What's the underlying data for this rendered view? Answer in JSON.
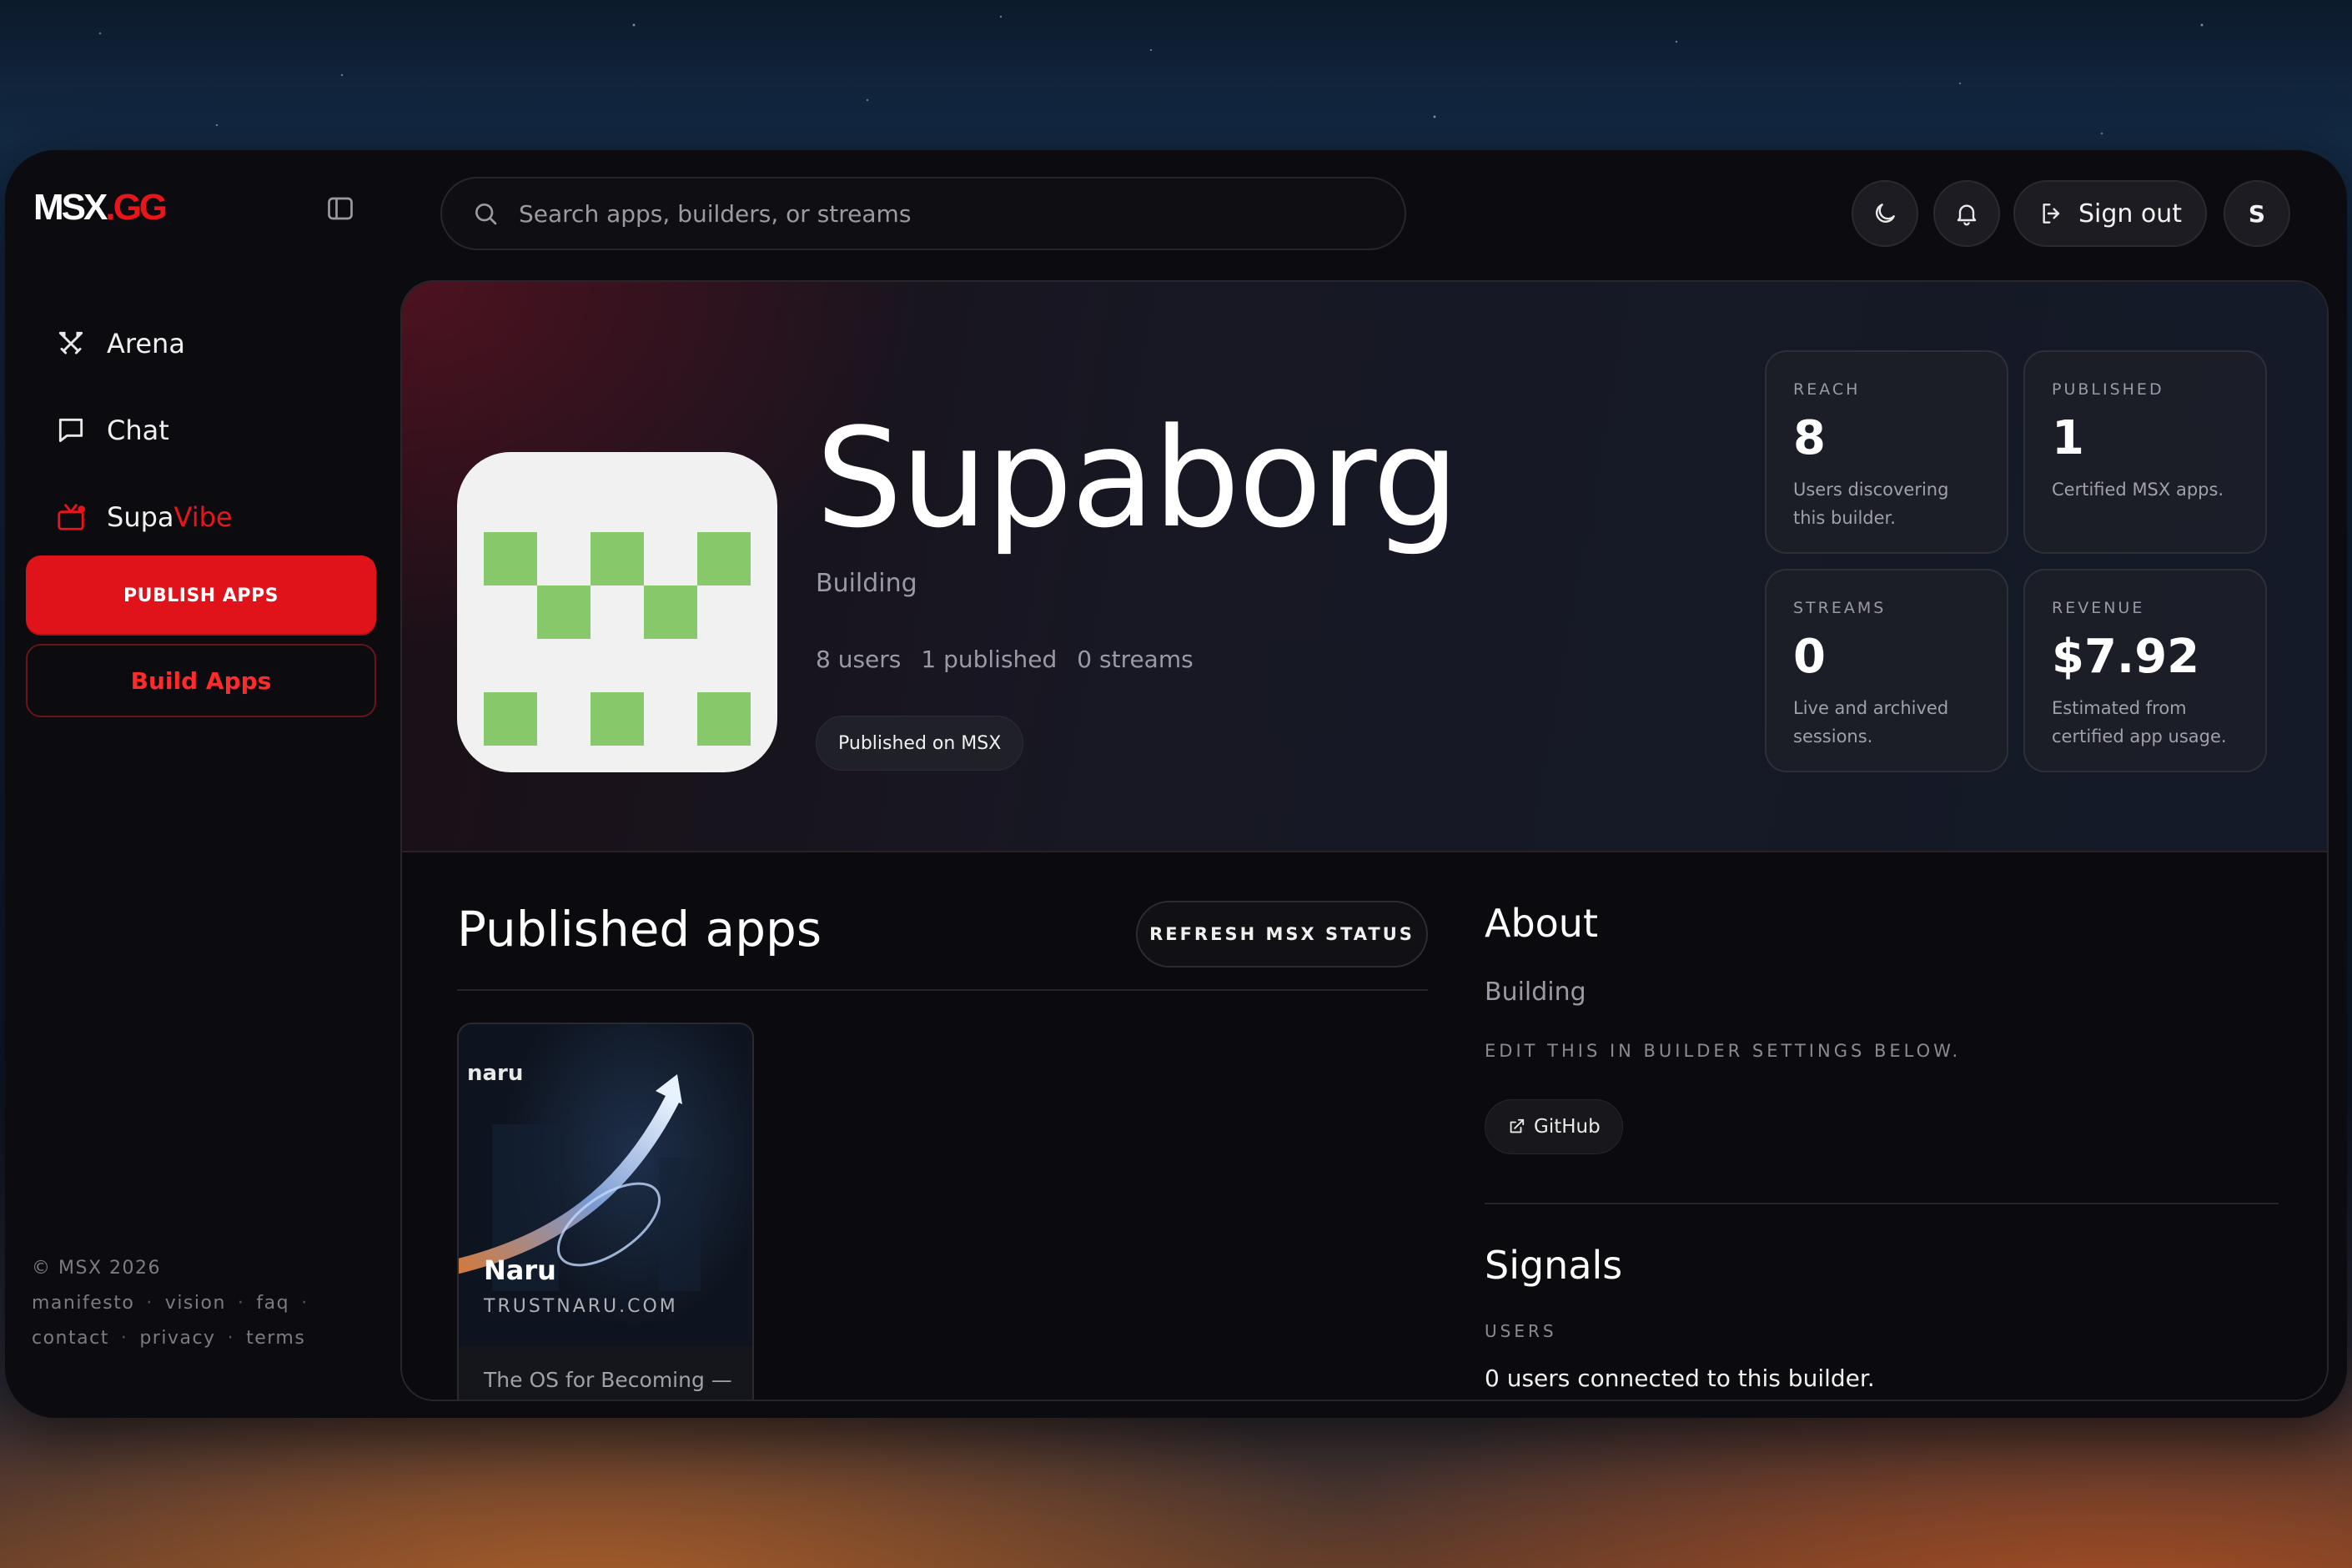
{
  "logo": {
    "part1": "MSX",
    "part2": ".GG"
  },
  "sidebar": {
    "items": [
      {
        "label": "Arena",
        "icon": "swords-icon"
      },
      {
        "label": "Chat",
        "icon": "chat-bubble-icon"
      },
      {
        "label_a": "Supa",
        "label_b": "Vibe",
        "icon": "tv-icon"
      }
    ],
    "publish_label": "PUBLISH APPS",
    "build_label": "Build Apps",
    "footer": {
      "copyright": "© MSX 2026",
      "links_row1": [
        "manifesto",
        "vision",
        "faq"
      ],
      "links_row2": [
        "contact",
        "privacy",
        "terms"
      ]
    }
  },
  "topbar": {
    "search_placeholder": "Search apps, builders, or streams",
    "signout_label": "Sign out",
    "avatar_initial": "S"
  },
  "hero": {
    "title": "Supaborg",
    "subtitle": "Building",
    "stats": [
      "8 users",
      "1 published",
      "0 streams"
    ],
    "badge": "Published on MSX"
  },
  "cards": [
    {
      "key": "REACH",
      "value": "8",
      "desc": "Users discovering this builder."
    },
    {
      "key": "PUBLISHED",
      "value": "1",
      "desc": "Certified MSX apps."
    },
    {
      "key": "STREAMS",
      "value": "0",
      "desc": "Live and archived sessions."
    },
    {
      "key": "REVENUE",
      "value": "$7.92",
      "desc": "Estimated from certified app usage."
    }
  ],
  "published": {
    "title": "Published apps",
    "refresh_label": "REFRESH MSX STATUS",
    "apps": [
      {
        "brand": "naru",
        "name": "Naru",
        "domain": "TRUSTNARU.COM",
        "tagline": "The OS for Becoming —"
      }
    ]
  },
  "about": {
    "title": "About",
    "subtitle": "Building",
    "edit_hint": "EDIT THIS IN BUILDER SETTINGS BELOW.",
    "github_label": "GitHub"
  },
  "signals": {
    "title": "Signals",
    "key": "USERS",
    "value": "0 users connected to this builder."
  },
  "colors": {
    "accent": "#e0121a",
    "icon_green": "#86c86a"
  }
}
